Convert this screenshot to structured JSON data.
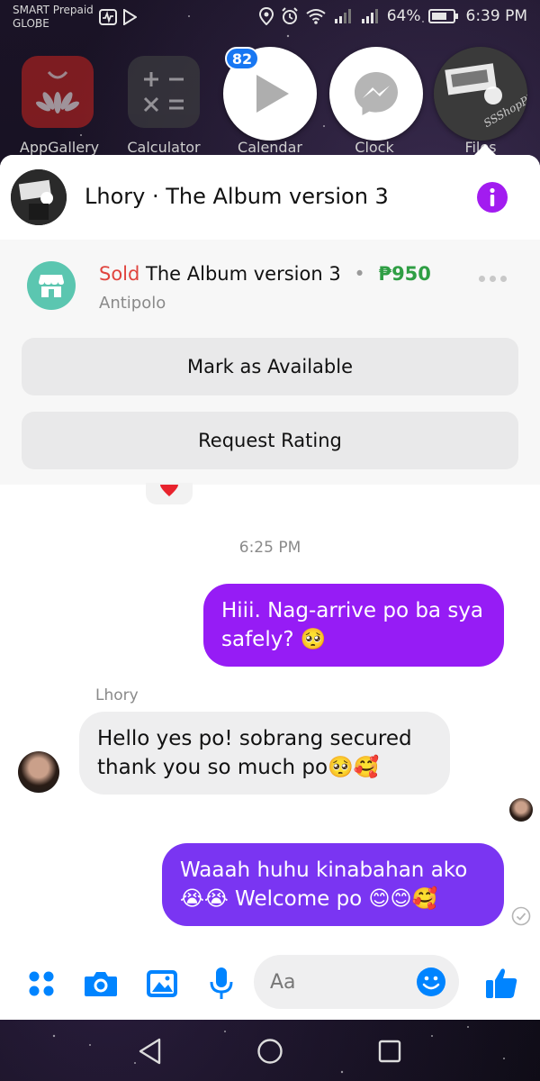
{
  "status_bar": {
    "carrier_1": "SMART Prepaid",
    "carrier_2": "GLOBE",
    "battery": "64%",
    "time": "6:39 PM"
  },
  "home_apps": [
    {
      "label": "AppGallery",
      "icon": "huawei-appgallery-icon"
    },
    {
      "label": "Calculator",
      "icon": "calculator-icon"
    },
    {
      "label": "Calendar",
      "icon": "play-icon"
    },
    {
      "label": "Clock",
      "icon": "messenger-icon"
    },
    {
      "label": "Files",
      "icon": "album-photo"
    }
  ],
  "chat_heads": {
    "badge_count": "82"
  },
  "chat": {
    "title": "Lhory · The Album version 3",
    "info_icon": "info-icon",
    "accent_color": "#8a1eff"
  },
  "listing": {
    "status": "Sold",
    "item_name": "The Album version 3",
    "separator": "•",
    "price": "₱950",
    "location": "Antipolo",
    "mark_available_label": "Mark as Available",
    "request_rating_label": "Request Rating"
  },
  "messages": {
    "timestamp": "6:25 PM",
    "outgoing_1": "Hiii. Nag-arrive po ba sya safely? 🥺",
    "sender_name": "Lhory",
    "incoming_1": "Hello yes po! sobrang secured thank you so much po🥺🥰",
    "outgoing_2": "Waaah huhu kinabahan ako 😭😭 Welcome po 😊😊🥰"
  },
  "composer": {
    "placeholder": "Aa",
    "icons": [
      "apps-icon",
      "camera-icon",
      "gallery-icon",
      "mic-icon",
      "emoji-icon",
      "like-icon"
    ]
  },
  "colors": {
    "messenger_blue": "#0084ff",
    "bubble_purple_1": "#9b1cf5",
    "bubble_purple_2": "#7b34f2",
    "sold_red": "#e0443e",
    "price_green": "#2f9e44"
  }
}
